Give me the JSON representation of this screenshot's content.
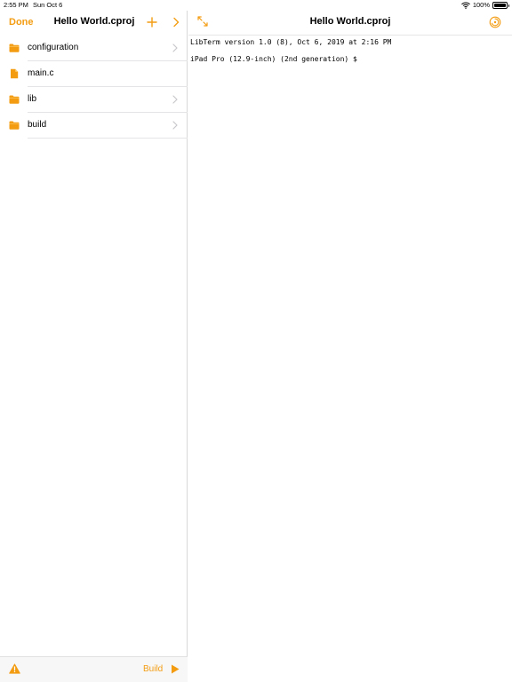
{
  "status_bar": {
    "time": "2:55 PM",
    "date": "Sun Oct 6",
    "battery": "100%"
  },
  "sidebar": {
    "done_label": "Done",
    "title": "Hello World.cproj",
    "files": [
      {
        "name": "configuration",
        "type": "folder",
        "has_chevron": true
      },
      {
        "name": "main.c",
        "type": "file",
        "has_chevron": false
      },
      {
        "name": "lib",
        "type": "folder",
        "has_chevron": true
      },
      {
        "name": "build",
        "type": "folder",
        "has_chevron": true
      }
    ],
    "toolbar": {
      "build_label": "Build"
    }
  },
  "main": {
    "title": "Hello World.cproj",
    "terminal_lines": [
      "LibTerm version 1.0 (8), Oct 6, 2019 at 2:16 PM",
      "iPad Pro (12.9-inch) (2nd generation) $"
    ]
  },
  "colors": {
    "accent": "#F39C12",
    "separator": "#E4E4E7"
  },
  "icons": {
    "add": "plus-icon",
    "forward": "chevron-right-icon",
    "folder": "folder-icon",
    "file": "document-icon",
    "warning": "warning-icon",
    "run": "play-icon",
    "expand": "expand-arrows-icon",
    "settings": "gear-icon"
  }
}
